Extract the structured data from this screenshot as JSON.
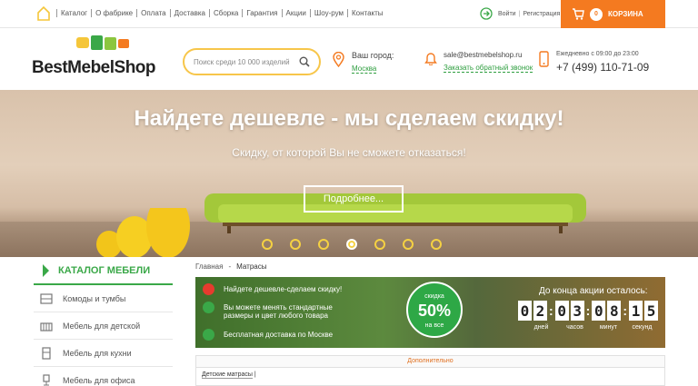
{
  "topbar": {
    "nav": [
      "Каталог",
      "О фабрике",
      "Оплата",
      "Доставка",
      "Сборка",
      "Гарантия",
      "Акции",
      "Шоу-рум",
      "Контакты"
    ],
    "login": "Войти",
    "register": "Регистрация",
    "cart_count": "0",
    "cart_label": "КОРЗИНА",
    "accent": "#f47a20"
  },
  "header": {
    "logo": "BestMebelShop",
    "search_placeholder": "Поиск среди 10 000 изделий",
    "city_label": "Ваш город:",
    "city_value": "Москва",
    "email": "sale@bestmebelshop.ru",
    "callback": "Заказать обратный звонок",
    "hours": "Ежедневно с 09:00 до 23:00",
    "phone": "+7 (499) 110-71-09"
  },
  "banner": {
    "title": "Найдете дешевле - мы сделаем скидку!",
    "subtitle": "Скидку, от которой Вы не сможете отказаться!",
    "button": "Подробнее...",
    "slides": 7,
    "active_slide": 4
  },
  "sidebar": {
    "title": "КАТАЛОГ МЕБЕЛИ",
    "items": [
      "Комоды и тумбы",
      "Мебель для детской",
      "Мебель для кухни",
      "Мебель для офиса"
    ]
  },
  "breadcrumb": {
    "home": "Главная",
    "sep": "-",
    "current": "Матрасы"
  },
  "promo": {
    "lines": [
      "Найдете дешевле-сделаем скидку!",
      "Вы можете менять стандартные",
      "размеры и цвет любого товара",
      "Бесплатная доставка по Москве"
    ],
    "badge_top": "скидка",
    "badge_value": "50%",
    "badge_bottom": "на все",
    "timer_title": "До конца акции осталось:",
    "digits": [
      "0",
      "2",
      "0",
      "3",
      "0",
      "8",
      "1",
      "5"
    ],
    "timer_labels": [
      "дней",
      "часов",
      "минут",
      "секунд"
    ]
  },
  "extra_label": "Дополнительно",
  "subcategory": "Детские матрасы"
}
